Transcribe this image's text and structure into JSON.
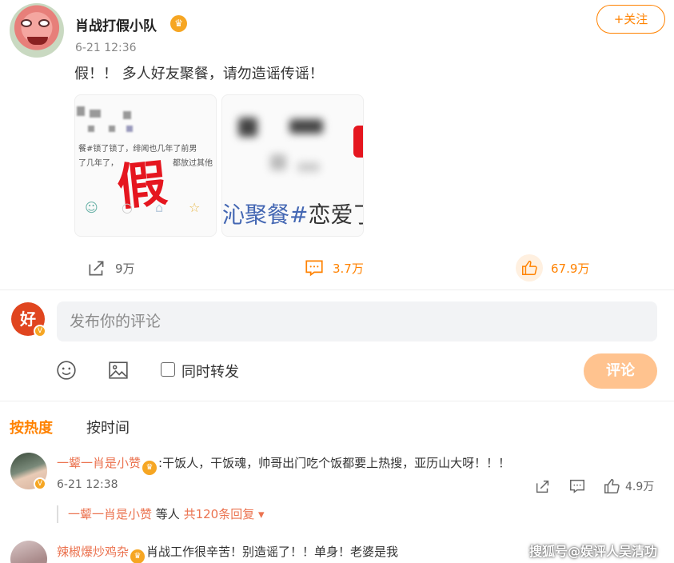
{
  "post": {
    "author": "肖战打假小队",
    "time": "6-21 12:36",
    "follow_label": "+关注",
    "text": "假！！ 多人好友聚餐，请勿造谣传谣！",
    "images": {
      "img1": {
        "line1": "餐#锁了锁了，绯闻也几年了前男",
        "line2": "了几年了，",
        "line3": "都放过其他",
        "big_char": "假"
      },
      "img2": {
        "text_blue": "沁聚餐#",
        "text_dark": "恋爱了"
      }
    },
    "share_count": "9万",
    "comment_count": "3.7万",
    "like_count": "67.9万"
  },
  "composer": {
    "avatar_char": "好",
    "placeholder": "发布你的评论",
    "repost_label": "同时转发",
    "submit_label": "评论"
  },
  "sort": {
    "hot": "按热度",
    "time": "按时间"
  },
  "comments": [
    {
      "user": "一颦一肖是小赞",
      "text": ":干饭人，干饭魂，帅哥出门吃个饭都要上热搜，亚历山大呀！！！",
      "time": "6-21 12:38",
      "likes": "4.9万",
      "reply_user": "一颦一肖是小赞",
      "reply_mid": " 等人 ",
      "reply_count": "共120条回复"
    },
    {
      "user": "辣椒爆炒鸡杂",
      "text": "肖战工作很辛苦！别造谣了！！单身！老婆是我"
    }
  ],
  "watermark": "搜狐号@娱评人吴清功",
  "colors": {
    "accent": "#ff8200",
    "username": "#eb7350",
    "submit_disabled": "#ffc38f"
  }
}
